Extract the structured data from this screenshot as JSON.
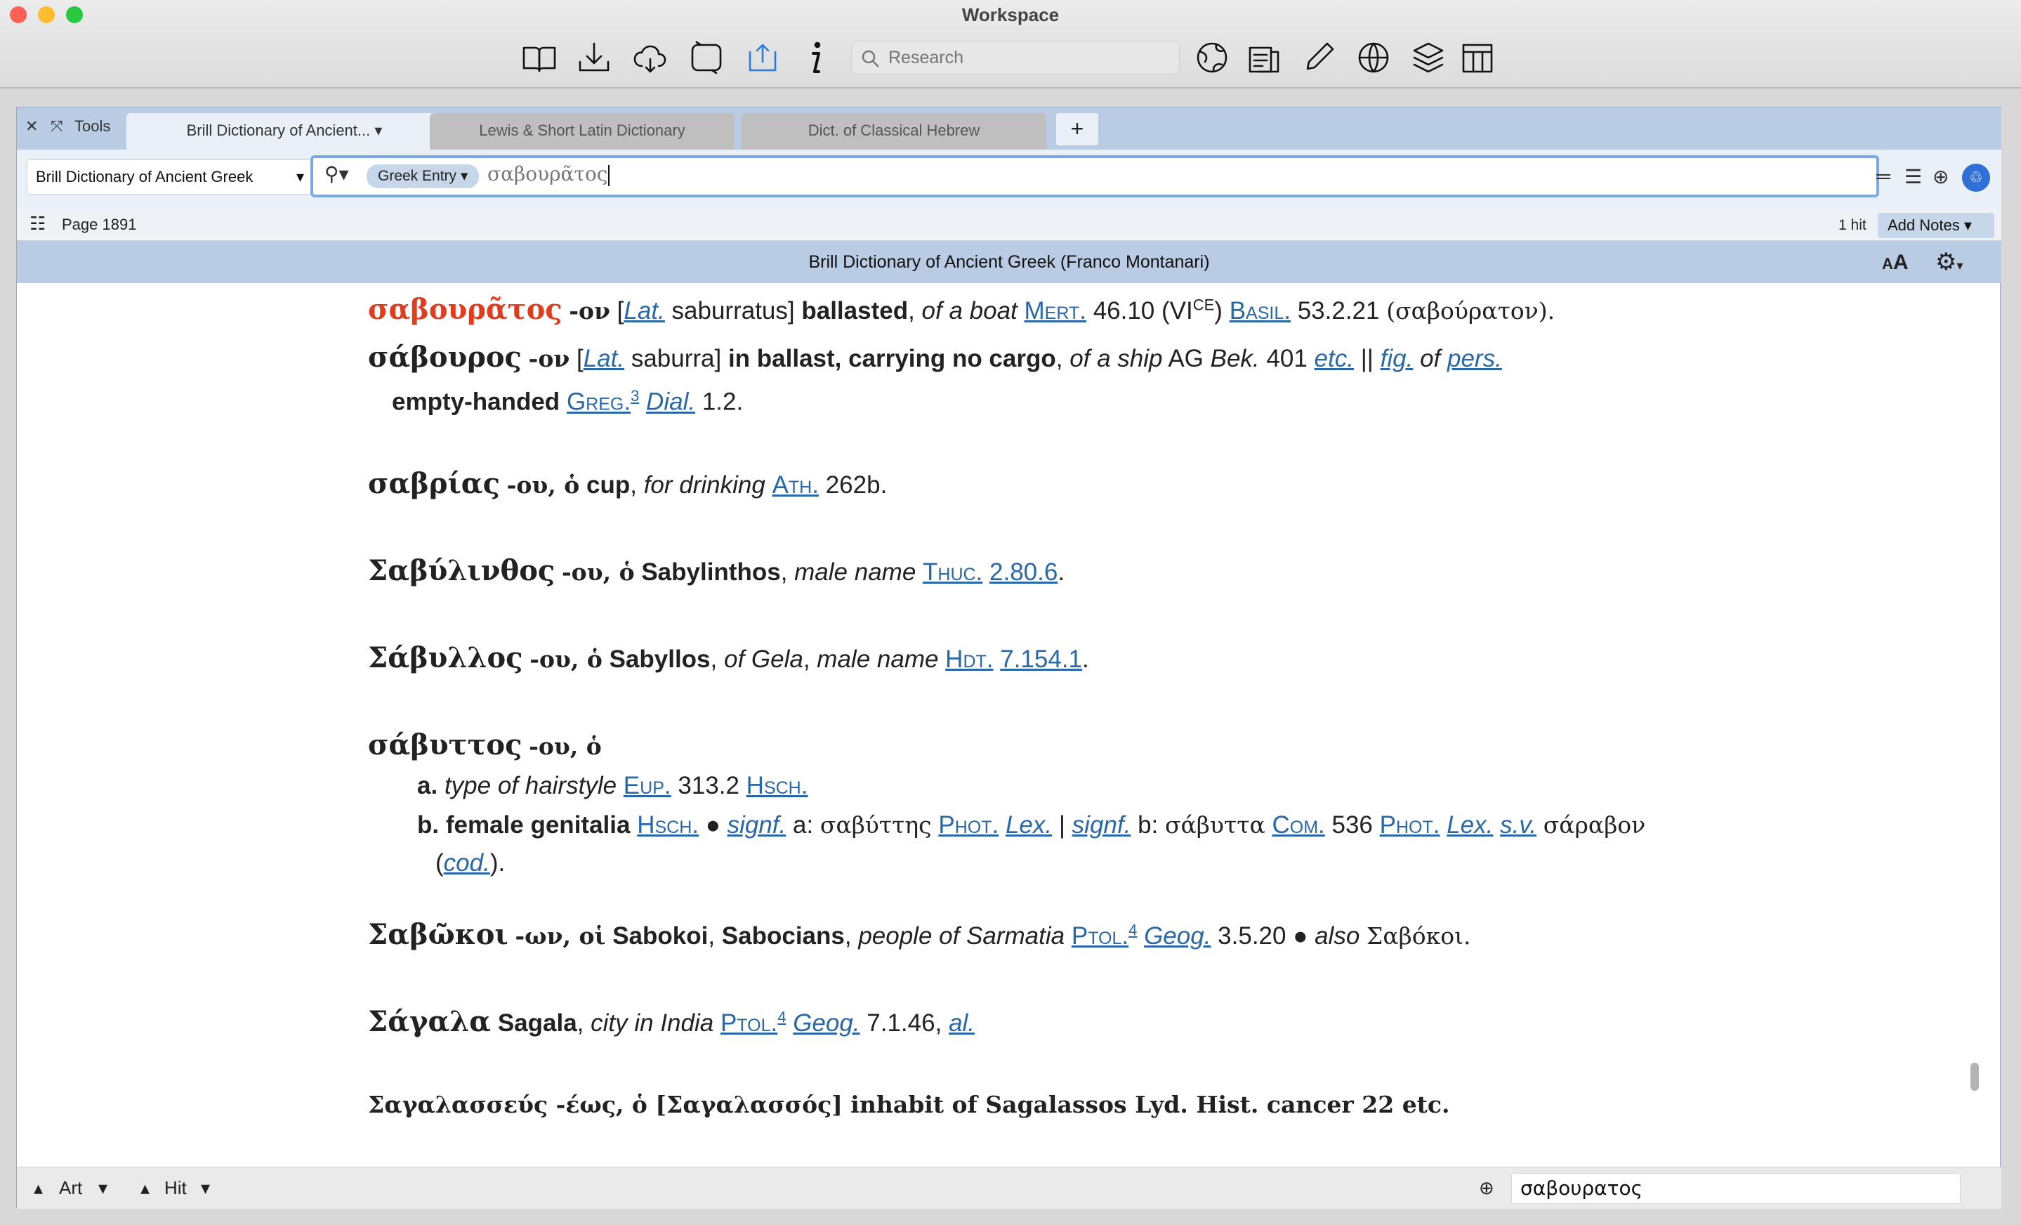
{
  "window": {
    "title": "Workspace"
  },
  "toolbar": {
    "icons": [
      "library-icon",
      "download-icon",
      "cloud-sync-icon",
      "sync-icon",
      "share-icon",
      "info-icon",
      "globe-icon",
      "passage-guide-icon",
      "highlight-icon",
      "www-icon",
      "layers-icon",
      "layout-icon"
    ],
    "research_placeholder": "Research"
  },
  "tabs": {
    "tools_label": "Tools",
    "items": [
      {
        "label": "Brill Dictionary of Ancient..."
      },
      {
        "label": "Lewis & Short Latin Dictionary"
      },
      {
        "label": "Dict. of Classical Hebrew"
      }
    ],
    "plus": "+"
  },
  "search": {
    "book": "Brill Dictionary of Ancient Greek",
    "type": "Greek Entry",
    "query": "σαβουρᾶτος"
  },
  "pagebar": {
    "page": "Page 1891",
    "hits": "1 hit",
    "add_notes": "Add Notes"
  },
  "document": {
    "title": "Brill Dictionary of Ancient Greek (Franco Montanari)",
    "font_size_icon": "AA"
  },
  "entries": {
    "e1": {
      "head": "σαβουρᾶτος",
      "form": "-ον",
      "lat": "Lat.",
      "lat_word": "saburratus",
      "gloss": "ballasted",
      "note": "of a boat",
      "ref1": "Mert.",
      "num1": "46.10 (VI",
      "sup1": "CE",
      ")close": ")",
      "ref2": "Basil.",
      "num2": "53.2.21",
      "greek": "(σαβούρατον)."
    },
    "e2": {
      "head": "σάβουρος",
      "form": "-ον",
      "lat": "Lat.",
      "lat_word": "saburra",
      "gloss": "in ballast, carrying no cargo",
      "note": "of a ship",
      "ag": "AG",
      "bek": "Bek.",
      "num": "401",
      "etc": "etc.",
      "sep": "||",
      "fig": "fig.",
      "of": "of",
      "pers": "pers.",
      "gloss2": "empty-handed",
      "ref": "Greg.",
      "sup": "3",
      "dial": "Dial.",
      "num2": "1.2."
    },
    "e3": {
      "head": "σαβρίας",
      "form": "-ου, ὁ",
      "gloss": "cup",
      "note": "for drinking",
      "ref": "Ath.",
      "num": "262b."
    },
    "e4": {
      "head": "Σαβύλινθος",
      "form": "-ου, ὁ",
      "gloss": "Sabylinthos",
      "note": "male name",
      "ref": "Thuc.",
      "num": "2.80.6"
    },
    "e5": {
      "head": "Σάβυλλος",
      "form": "-ου, ὁ",
      "gloss": "Sabyllos",
      "note": "of Gela",
      "note2": "male name",
      "ref": "Hdt.",
      "num": "7.154.1"
    },
    "e6": {
      "head": "σάβυττος",
      "form": "-ου, ὁ",
      "a_label": "a.",
      "a_note": "type of hairstyle",
      "a_ref1": "Eup.",
      "a_num": "313.2",
      "a_ref2": "Hsch.",
      "b_label": "b.",
      "b_gloss": "female genitalia",
      "b_ref1": "Hsch.",
      "bullet": "●",
      "signf": "signf.",
      "b_a": "a:",
      "b_gk1": "σαβύττης",
      "phot": "Phot.",
      "lex": "Lex.",
      "bar": "|",
      "signf2": "signf.",
      "b_b": "b:",
      "b_gk2": "σάβυττα",
      "com": "Com.",
      "b_num": "536",
      "phot2": "Phot.",
      "lex2": "Lex.",
      "sv": "s.v.",
      "b_gk3": "σάραβον",
      "cod": "cod."
    },
    "e7": {
      "head": "Σαβῶκοι",
      "form": "-ων, οἱ",
      "gloss": "Sabokoi",
      "gloss2": "Sabocians",
      "note": "people of Sarmatia",
      "ref": "Ptol.",
      "sup": "4",
      "geog": "Geog.",
      "num": "3.5.20",
      "bullet": "●",
      "also": "also",
      "gk": "Σαβόκοι."
    },
    "e8": {
      "head": "Σάγαλα",
      "gloss": "Sagala",
      "note": "city in India",
      "ref": "Ptol.",
      "sup": "4",
      "geog": "Geog.",
      "num": "7.1.46,",
      "al": "al."
    },
    "e9": {
      "partial": "Σαγαλασσεύς -έως, ὁ [Σαγαλασσός] inhabit of Sagalassos Lyd. Hist. cancer 22 etc."
    }
  },
  "statusbar": {
    "art": "Art",
    "hit": "Hit",
    "search_text": "σαβουρατος"
  },
  "colors": {
    "headword_red": "#e03c1e",
    "link_blue": "#2867a8",
    "tab_bar": "#b9cce4",
    "accent": "#2f6fd8"
  }
}
